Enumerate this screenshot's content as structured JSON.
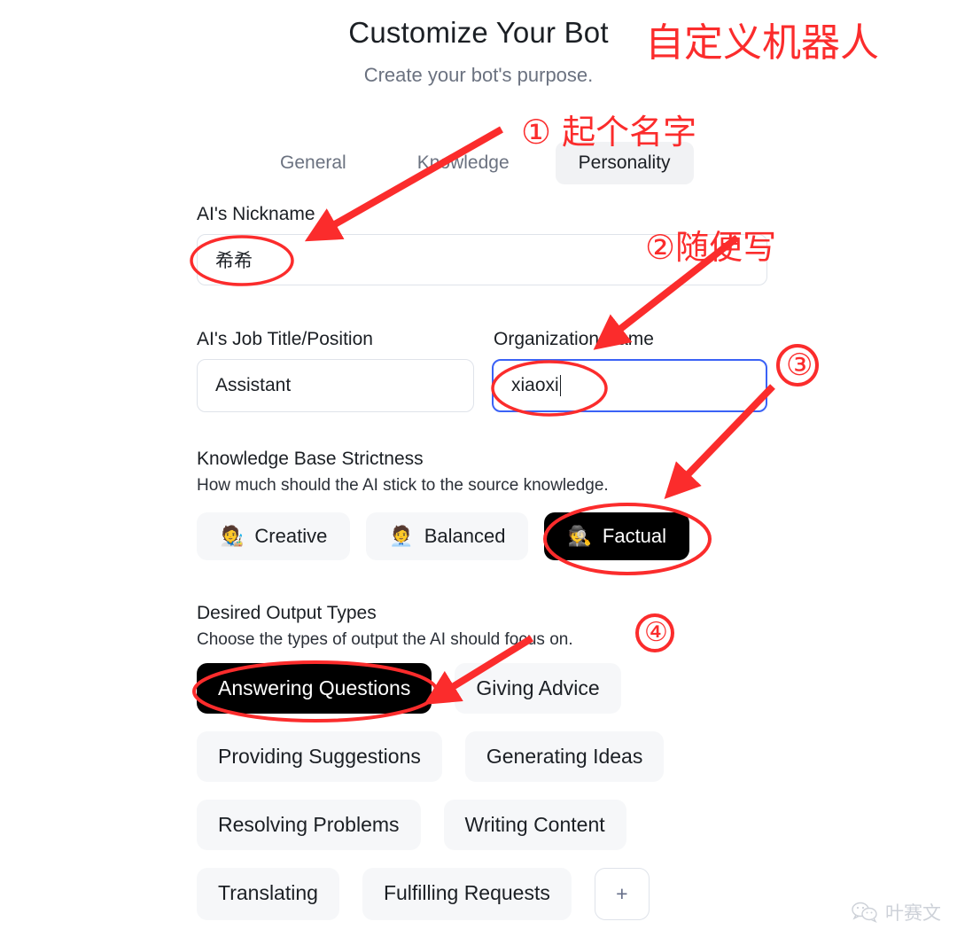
{
  "header": {
    "title": "Customize Your Bot",
    "subtitle": "Create your bot's purpose."
  },
  "tabs": [
    {
      "label": "General",
      "active": false
    },
    {
      "label": "Knowledge",
      "active": false
    },
    {
      "label": "Personality",
      "active": true
    }
  ],
  "form": {
    "nickname": {
      "label": "AI's Nickname",
      "value": "希希"
    },
    "job_title": {
      "label": "AI's Job Title/Position",
      "value": "Assistant"
    },
    "organization": {
      "label": "Organization Name",
      "value": "xiaoxi",
      "focused": true
    }
  },
  "strictness": {
    "title": "Knowledge Base Strictness",
    "description": "How much should the AI stick to the source knowledge.",
    "options": [
      {
        "emoji": "🧑‍🎨",
        "label": "Creative",
        "selected": false
      },
      {
        "emoji": "🧑‍💼",
        "label": "Balanced",
        "selected": false
      },
      {
        "emoji": "🕵️",
        "label": "Factual",
        "selected": true
      }
    ]
  },
  "output_types": {
    "title": "Desired Output Types",
    "description": "Choose the types of output the AI should focus on.",
    "chips": [
      {
        "label": "Answering Questions",
        "selected": true
      },
      {
        "label": "Giving Advice",
        "selected": false
      },
      {
        "label": "Providing Suggestions",
        "selected": false
      },
      {
        "label": "Generating Ideas",
        "selected": false
      },
      {
        "label": "Resolving Problems",
        "selected": false
      },
      {
        "label": "Writing Content",
        "selected": false
      },
      {
        "label": "Translating",
        "selected": false
      },
      {
        "label": "Fulfilling Requests",
        "selected": false
      }
    ],
    "add_label": "+"
  },
  "annotations": {
    "color": "#fb2c2c",
    "title_note": "自定义机器人",
    "step1": "① 起个名字",
    "step2": "②随便写",
    "step3": "③",
    "step4": "④"
  },
  "watermark": {
    "text": "叶赛文"
  }
}
